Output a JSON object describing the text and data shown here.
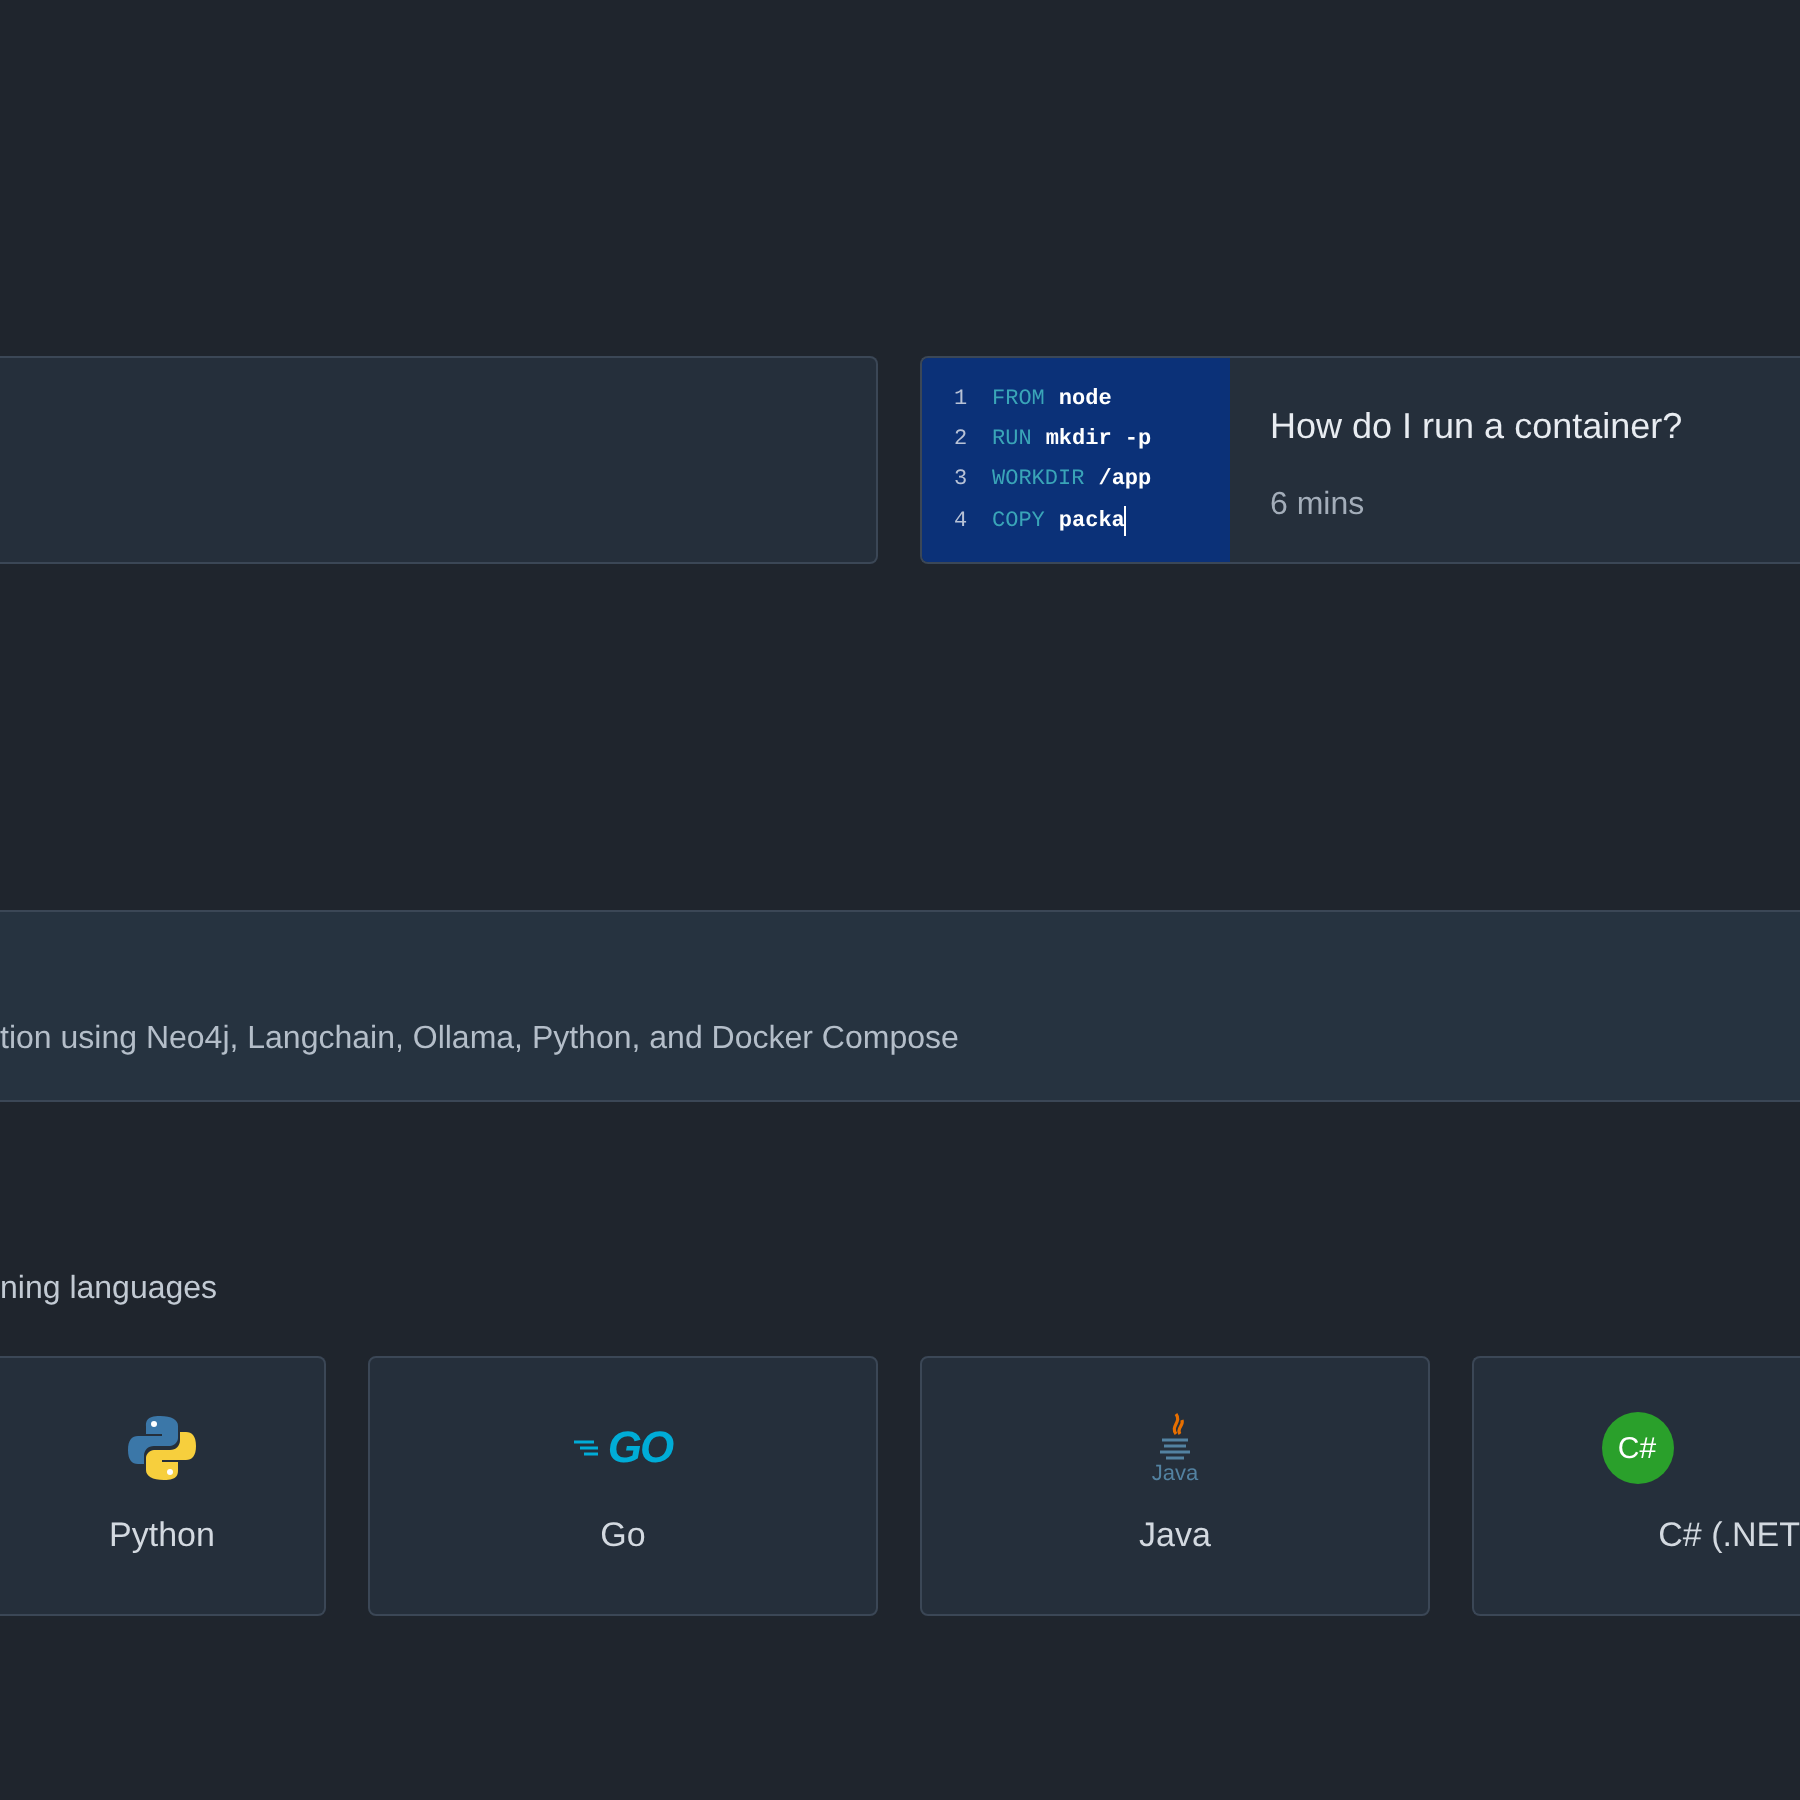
{
  "guides": [
    {
      "kind": "blank"
    },
    {
      "kind": "code",
      "title": "How do I run a container?",
      "duration": "6 mins",
      "code_lines": [
        {
          "number": "1",
          "keyword": "FROM",
          "value": "node",
          "cursor": false
        },
        {
          "number": "2",
          "keyword": "RUN",
          "value": "mkdir -p",
          "cursor": false
        },
        {
          "number": "3",
          "keyword": "WORKDIR",
          "value": "/app",
          "cursor": false
        },
        {
          "number": "4",
          "keyword": "COPY",
          "value": "packa",
          "cursor": true
        }
      ]
    }
  ],
  "banner": {
    "description": "tion using Neo4j, Langchain, Ollama, Python, and Docker Compose"
  },
  "languages_heading": "ning languages",
  "languages": [
    {
      "kind": "python",
      "label": "Python"
    },
    {
      "kind": "go",
      "label": "Go",
      "logo_text": "GO"
    },
    {
      "kind": "java",
      "label": "Java",
      "logo_text": "Java"
    },
    {
      "kind": "csharp",
      "label": "C# (.NET",
      "logo_text": "C#"
    }
  ]
}
